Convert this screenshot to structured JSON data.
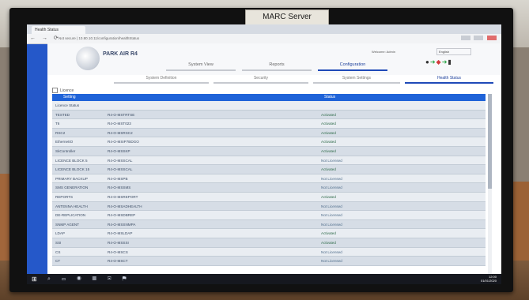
{
  "monitor_label": "MARC Server",
  "browser": {
    "tab_title": "Health Status",
    "url": "Not secure | 10.80.10.11/configuration/healthStatus",
    "nav_icons": "← → ⟳"
  },
  "app": {
    "brand": "PARK AIR R4",
    "welcome": "Welcome: Admin",
    "language": "English",
    "main_nav": [
      {
        "label": "System View"
      },
      {
        "label": "Reports"
      },
      {
        "label": "Configuration"
      }
    ],
    "sub_nav": [
      {
        "label": "System Definition"
      },
      {
        "label": "Security"
      },
      {
        "label": "System Settings"
      },
      {
        "label": "Health Status"
      }
    ],
    "checkbox_label": "Licence",
    "table": {
      "headers": [
        "Setting",
        "Status"
      ],
      "section_label": "Licence Status",
      "rows": [
        {
          "name": "TESTED",
          "code": "R4-O-MSTRTSE",
          "status": "Activated"
        },
        {
          "name": "T6",
          "code": "R4-O-MST023",
          "status": "Activated"
        },
        {
          "name": "RSC2",
          "code": "R4-O-MSRSC2",
          "status": "Activated"
        },
        {
          "name": "EthernetIO",
          "code": "R4-O-MSIP7BDGO",
          "status": "Activated"
        },
        {
          "name": "SkController",
          "code": "R4-O-MSSKP",
          "status": "Activated"
        },
        {
          "name": "LICENCE BLOCK 5",
          "code": "R4-O-MSSCAL",
          "status": "Not Licensed"
        },
        {
          "name": "LICENCE BLOCK 15",
          "code": "R4-O-MSSCAL",
          "status": "Activated"
        },
        {
          "name": "PRIMARY BACKUP",
          "code": "R4-O-MSPB",
          "status": "Not Licensed"
        },
        {
          "name": "SMS GENERATION",
          "code": "R4-O-MSSMS",
          "status": "Not Licensed"
        },
        {
          "name": "REPORTS",
          "code": "R4-O-MSREPORT",
          "status": "Activated"
        },
        {
          "name": "ANTENNA HEALTH",
          "code": "R4-O-MSADHEALTH",
          "status": "Not Licensed"
        },
        {
          "name": "DE-REPLICATION",
          "code": "R4-O-MSDBREP",
          "status": "Not Licensed"
        },
        {
          "name": "SNMP AGENT",
          "code": "R4-O-MSSNMPA",
          "status": "Not Licensed"
        },
        {
          "name": "LDAP",
          "code": "R4-O-MSLDAP",
          "status": "Activated"
        },
        {
          "name": "SSI",
          "code": "R4-O-MSSSI",
          "status": "Activated"
        },
        {
          "name": "CS",
          "code": "R4-O-MSCS",
          "status": "Not Licensed"
        },
        {
          "name": "CT",
          "code": "R4-O-MSCT",
          "status": "Not Licensed"
        }
      ]
    }
  },
  "taskbar": {
    "start": "⊞",
    "apps": "⌕ ▭ ◉ ▦ ✉ ⚑",
    "time": "12:00",
    "date": "01/01/2020"
  },
  "colors": {
    "accent": "#1f4ab8",
    "header_row": "#1f63d8",
    "desktop": "#2558c9"
  }
}
